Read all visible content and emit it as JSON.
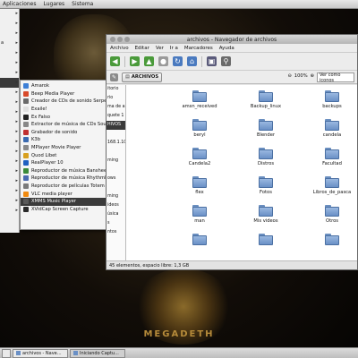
{
  "top_panel": {
    "items": [
      "Aplicaciones",
      "Lugares",
      "Sistema"
    ]
  },
  "left_menu": {
    "items": [
      "",
      "",
      "",
      "a",
      "",
      "",
      "",
      "",
      "",
      "",
      "",
      "",
      "",
      "",
      "",
      "",
      "",
      "",
      "",
      "",
      ""
    ],
    "selected_index": 7
  },
  "submenu": {
    "items": [
      {
        "label": "Amarok",
        "color": "#3d7fd6"
      },
      {
        "label": "Beep Media Player",
        "color": "#d84a2a"
      },
      {
        "label": "Creador de CDs de sonido Serpentine",
        "color": "#6a6a6a"
      },
      {
        "label": "Exaile!",
        "color": "#e0e0e0"
      },
      {
        "label": "Ex Falso",
        "color": "#202020"
      },
      {
        "label": "Extractor de música de CDs Sound Juicer",
        "color": "#888888"
      },
      {
        "label": "Grabador de sonido",
        "color": "#c03030"
      },
      {
        "label": "K3b",
        "color": "#3a6ab0"
      },
      {
        "label": "MPlayer Movie Player",
        "color": "#8a8a8a"
      },
      {
        "label": "Quod Libet",
        "color": "#d8a020"
      },
      {
        "label": "RealPlayer 10",
        "color": "#2060c0"
      },
      {
        "label": "Reproductor de música Banshee",
        "color": "#3a8a3a"
      },
      {
        "label": "Reproductor de música Rhythmbox",
        "color": "#4a6ab0"
      },
      {
        "label": "Reproductor de películas Totem",
        "color": "#7a7a7a"
      },
      {
        "label": "VLC media player",
        "color": "#f08a10"
      },
      {
        "label": "XMMS Music Player",
        "color": "#5a5a5a"
      },
      {
        "label": "XVidCap Screen Capture",
        "color": "#2a2a2a"
      }
    ],
    "selected_index": 15
  },
  "window": {
    "title": "archivos - Navegador de archivos",
    "menu": [
      "Archivo",
      "Editar",
      "Ver",
      "Ir a",
      "Marcadores",
      "Ayuda"
    ],
    "toolbar_icons": [
      {
        "name": "back-icon",
        "glyph": "◀",
        "color": "#4a9a3a"
      },
      {
        "name": "forward-icon",
        "glyph": "▶",
        "color": "#4a9a3a"
      },
      {
        "name": "up-icon",
        "glyph": "▲",
        "color": "#4a9a3a"
      },
      {
        "name": "stop-icon",
        "glyph": "●",
        "color": "#9a9a9a"
      },
      {
        "name": "reload-icon",
        "glyph": "↻",
        "color": "#4a7abf"
      },
      {
        "name": "home-icon",
        "glyph": "⌂",
        "color": "#4a7abf"
      },
      {
        "name": "computer-icon",
        "glyph": "▣",
        "color": "#5a5a7a"
      },
      {
        "name": "search-icon",
        "glyph": "⚲",
        "color": "#6a6a6a"
      }
    ],
    "location": {
      "crumb": "ARCHIVOS",
      "zoom": "100%",
      "view": "Ver como iconos"
    },
    "sidebar": [
      "itorio",
      "rio",
      "ma de archivos",
      "quete 1",
      "HIVOS",
      "",
      "168.1.10",
      "",
      "ming",
      "",
      "ows",
      "",
      "ming",
      "ideos",
      "úsica",
      "s",
      "ntos"
    ],
    "sidebar_selected": 4,
    "files": [
      "amsn_received",
      "Backup_linux",
      "backups",
      "beryl",
      "Blender",
      "candela",
      "Candela2",
      "Distros",
      "Facultad",
      "flex",
      "Fotos",
      "Libros_de_pasca",
      "man",
      "Mis videos",
      "Otros",
      "",
      "",
      ""
    ],
    "status": "45 elementos, espacio libre: 1,3 GB"
  },
  "taskbar": {
    "items": [
      {
        "label": "archivos - Nave...",
        "active": false
      },
      {
        "label": "Iniciando Captu...",
        "active": true
      }
    ]
  },
  "wallpaper_text": "MEGADETH"
}
